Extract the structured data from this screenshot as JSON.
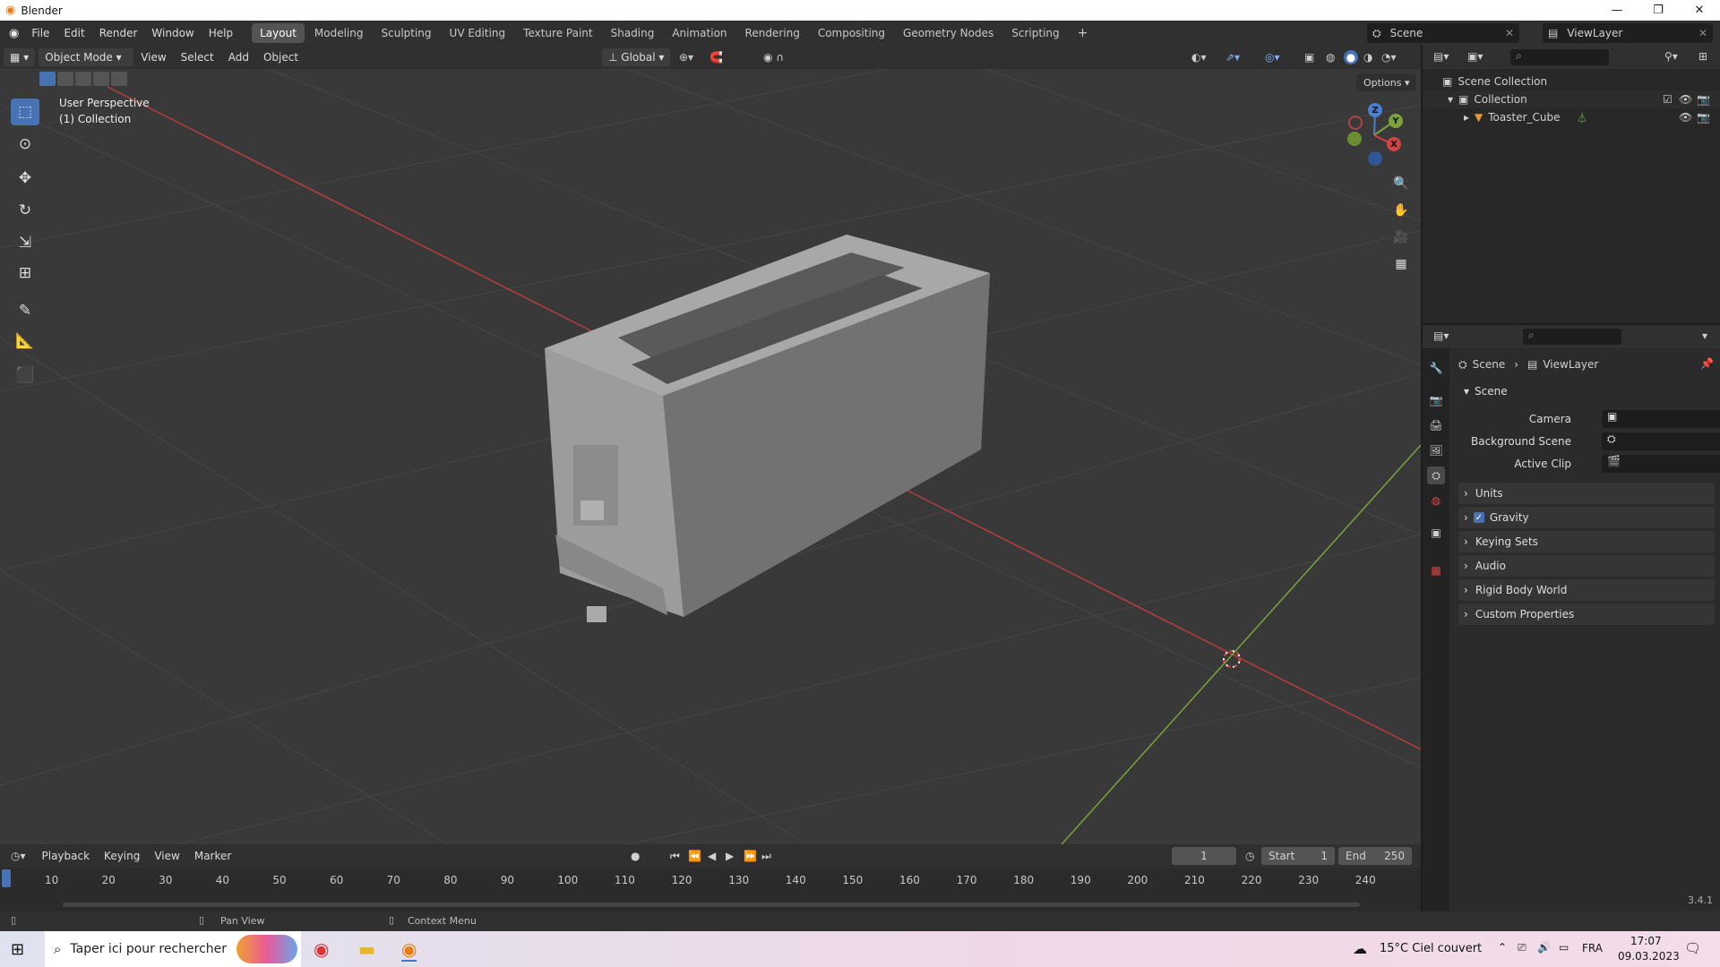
{
  "app": {
    "title": "Blender",
    "version": "3.4.1"
  },
  "window_controls": {
    "minimize": "—",
    "restore": "❐",
    "close": "✕"
  },
  "menu": [
    "File",
    "Edit",
    "Render",
    "Window",
    "Help"
  ],
  "workspaces": [
    {
      "label": "Layout",
      "active": true
    },
    {
      "label": "Modeling"
    },
    {
      "label": "Sculpting"
    },
    {
      "label": "UV Editing"
    },
    {
      "label": "Texture Paint"
    },
    {
      "label": "Shading"
    },
    {
      "label": "Animation"
    },
    {
      "label": "Rendering"
    },
    {
      "label": "Compositing"
    },
    {
      "label": "Geometry Nodes"
    },
    {
      "label": "Scripting"
    }
  ],
  "add_workspace": "+",
  "scene_selector": {
    "scene": "Scene",
    "view_layer": "ViewLayer"
  },
  "viewport_header": {
    "mode": "Object Mode",
    "menus": [
      "View",
      "Select",
      "Add",
      "Object"
    ],
    "transform_orientation": "Global",
    "options": "Options"
  },
  "viewport": {
    "perspective": "User Perspective",
    "collection": "(1) Collection",
    "gizmo": {
      "x": "X",
      "y": "Y",
      "z": "Z"
    }
  },
  "outliner": {
    "root": "Scene Collection",
    "items": [
      {
        "label": "Collection"
      },
      {
        "label": "Toaster_Cube"
      }
    ]
  },
  "properties": {
    "breadcrumb": {
      "scene": "Scene",
      "view_layer": "ViewLayer"
    },
    "scene_panel": {
      "title": "Scene",
      "camera_label": "Camera",
      "background_label": "Background Scene",
      "clip_label": "Active Clip"
    },
    "panels": [
      {
        "label": "Units"
      },
      {
        "label": "Gravity",
        "checked": true
      },
      {
        "label": "Keying Sets"
      },
      {
        "label": "Audio"
      },
      {
        "label": "Rigid Body World"
      },
      {
        "label": "Custom Properties"
      }
    ]
  },
  "timeline": {
    "menus": [
      "Playback",
      "Keying",
      "View",
      "Marker"
    ],
    "current_frame": "1",
    "start_label": "Start",
    "start": "1",
    "end_label": "End",
    "end": "250",
    "ticks": [
      "10",
      "20",
      "30",
      "40",
      "50",
      "60",
      "70",
      "80",
      "90",
      "100",
      "110",
      "120",
      "130",
      "140",
      "150",
      "160",
      "170",
      "180",
      "190",
      "200",
      "210",
      "220",
      "230",
      "240"
    ]
  },
  "statusbar": {
    "pan": "Pan View",
    "context": "Context Menu",
    "version": "3.4.1"
  },
  "taskbar": {
    "search_placeholder": "Taper ici pour rechercher",
    "weather": "15°C  Ciel couvert",
    "language": "FRA",
    "time": "17:07",
    "date": "09.03.2023"
  },
  "colors": {
    "accent": "#4772b3",
    "x_axis": "#b53d3d",
    "y_axis": "#7aa33a",
    "z_axis": "#4a7fd0",
    "active_tab": "#545454"
  }
}
